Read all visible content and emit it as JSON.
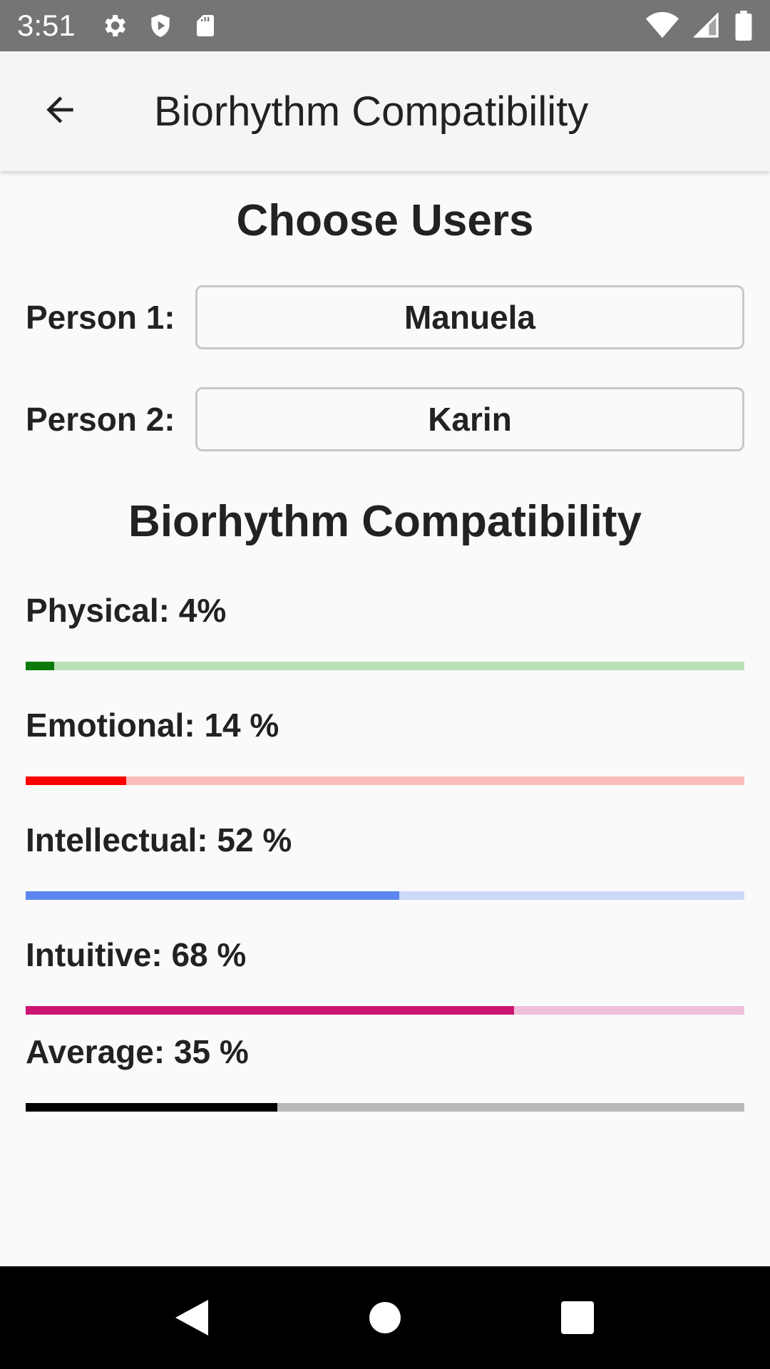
{
  "status": {
    "time": "3:51",
    "icons_left": [
      "gear-icon",
      "shield-play-icon",
      "sd-card-icon"
    ],
    "icons_right": [
      "wifi-icon",
      "signal-icon",
      "battery-icon"
    ]
  },
  "app_bar": {
    "back_icon": "arrow-left-icon",
    "title": "Biorhythm Compatibility"
  },
  "choose": {
    "title": "Choose Users",
    "person1_label": "Person 1:",
    "person1_value": "Manuela",
    "person2_label": "Person 2:",
    "person2_value": "Karin"
  },
  "compatibility": {
    "title": "Biorhythm Compatibility",
    "metrics": [
      {
        "label": "Physical: 4%",
        "value": 4,
        "color": "#0b7a0b",
        "track": "#b9dfb9"
      },
      {
        "label": "Emotional: 14 %",
        "value": 14,
        "color": "#ff0000",
        "track": "#fbbcbc"
      },
      {
        "label": "Intellectual: 52 %",
        "value": 52,
        "color": "#5b87ee",
        "track": "#ccd9f8"
      },
      {
        "label": "Intuitive: 68 %",
        "value": 68,
        "color": "#cc1573",
        "track": "#efc0da"
      },
      {
        "label": "Average: 35 %",
        "value": 35,
        "color": "#000000",
        "track": "#b9b9b9"
      }
    ]
  },
  "nav_bar": {
    "back": "triangle-back-icon",
    "home": "circle-home-icon",
    "recents": "square-recents-icon"
  }
}
